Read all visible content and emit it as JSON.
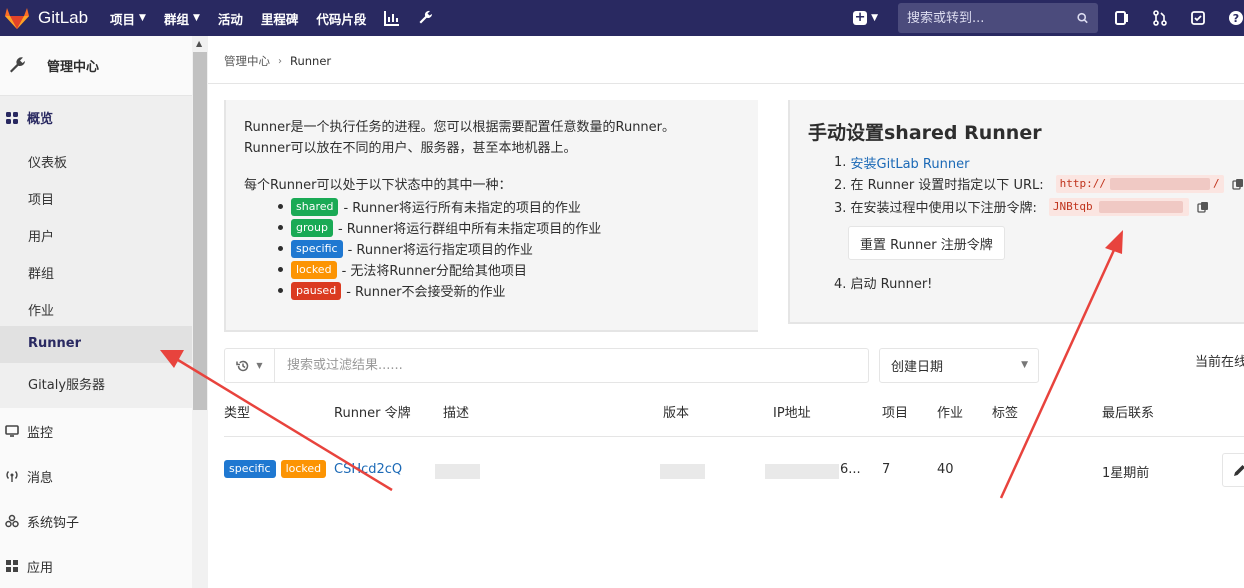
{
  "nav": {
    "brand": "GitLab",
    "items": [
      {
        "label": "项目",
        "caret": true
      },
      {
        "label": "群组",
        "caret": true
      },
      {
        "label": "活动",
        "caret": false
      },
      {
        "label": "里程碑",
        "caret": false
      },
      {
        "label": "代码片段",
        "caret": false
      }
    ],
    "search_placeholder": "搜索或转到..."
  },
  "sidebar": {
    "title": "管理中心",
    "overview": "概览",
    "sub_items": [
      "仪表板",
      "项目",
      "用户",
      "群组",
      "作业",
      "Runner",
      "Gitaly服务器"
    ],
    "active": "Runner",
    "sections": [
      "监控",
      "消息",
      "系统钩子",
      "应用"
    ]
  },
  "breadcrumb": {
    "parent": "管理中心",
    "current": "Runner"
  },
  "info": {
    "line1": "Runner是一个执行任务的进程。您可以根据需要配置任意数量的Runner。",
    "line2": "Runner可以放在不同的用户、服务器，甚至本地机器上。",
    "line3": "每个Runner可以处于以下状态中的其中一种：",
    "states": [
      {
        "badge": "shared",
        "text": "- Runner将运行所有未指定的项目的作业",
        "color": "#1aaa55"
      },
      {
        "badge": "group",
        "text": "- Runner将运行群组中所有未指定项目的作业",
        "color": "#1aaa55"
      },
      {
        "badge": "specific",
        "text": "- Runner将运行指定项目的作业",
        "color": "#1f78d1"
      },
      {
        "badge": "locked",
        "text": "- 无法将Runner分配给其他项目",
        "color": "#fc9403"
      },
      {
        "badge": "paused",
        "text": "- Runner不会接受新的作业",
        "color": "#db3b21"
      }
    ]
  },
  "manual": {
    "title": "手动设置shared Runner",
    "step1_num": "1.",
    "step1_link": "安装GitLab Runner",
    "step2": "2. 在 Runner 设置时指定以下 URL:",
    "url_start": "http://",
    "url_end": "/",
    "step3": "3. 在安装过程中使用以下注册令牌:",
    "token_start": "JNBtqb",
    "reset_button": "重置 Runner 注册令牌",
    "step4": "4. 启动 Runner!"
  },
  "filter": {
    "placeholder": "搜索或过滤结果......",
    "sort": "创建日期",
    "online_prefix": "当前在线"
  },
  "table": {
    "headers": [
      "类型",
      "Runner 令牌",
      "描述",
      "版本",
      "IP地址",
      "项目",
      "作业",
      "标签",
      "最后联系"
    ],
    "row": {
      "badges": [
        "specific",
        "locked"
      ],
      "token": "CSHcd2cQ",
      "ip_suffix": "6...",
      "projects": "7",
      "jobs": "40",
      "last_contact": "1星期前"
    }
  },
  "colors": {
    "nav_bg": "#292961",
    "link": "#1b69b6",
    "arrow": "#e8433d"
  }
}
